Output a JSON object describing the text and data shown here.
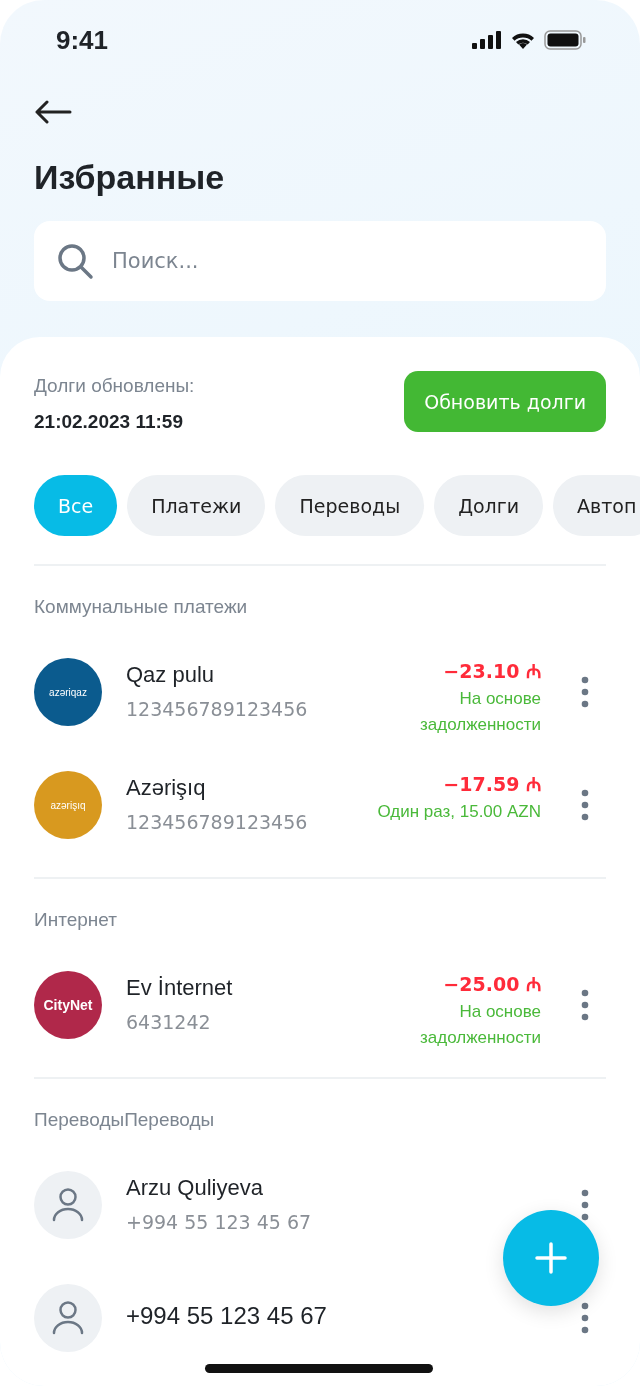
{
  "status_bar": {
    "time": "9:41"
  },
  "title": "Избранные",
  "search": {
    "placeholder": "Поиск..."
  },
  "debts": {
    "label": "Долги обновлены:",
    "date": "21:02.2023 11:59",
    "button": "Обновить долги"
  },
  "filters": [
    {
      "label": "Все",
      "selected": true
    },
    {
      "label": "Платежи",
      "selected": false
    },
    {
      "label": "Переводы",
      "selected": false
    },
    {
      "label": "Долги",
      "selected": false
    },
    {
      "label": "Автоп",
      "selected": false
    }
  ],
  "sections": [
    {
      "title": "Коммунальные платежи",
      "items": [
        {
          "kind": "logo",
          "logo_text": "azəriqaz",
          "color": "#0b5b8e",
          "name": "Qaz pulu",
          "number": "123456789123456",
          "amount": "−23.10 ₼",
          "note": "На основе задолженности"
        },
        {
          "kind": "logo",
          "logo_text": "azərişıq",
          "color": "#d8991f",
          "name": "Azərişıq",
          "number": "123456789123456",
          "amount": "−17.59 ₼",
          "note": "Один раз, 15.00 AZN"
        }
      ]
    },
    {
      "title": "Интернет",
      "items": [
        {
          "kind": "logo",
          "logo_text": "CityNet",
          "color": "#b0284a",
          "name": "Ev İnternet",
          "number": "6431242",
          "amount": "−25.00 ₼",
          "note": "На основе задолженности"
        }
      ]
    },
    {
      "title": "ПереводыПереводы",
      "items": [
        {
          "kind": "person",
          "name": "Arzu Quliyeva",
          "number": "+994 55 123 45 67"
        },
        {
          "kind": "person",
          "name": "+994 55 123 45 67"
        }
      ]
    }
  ]
}
